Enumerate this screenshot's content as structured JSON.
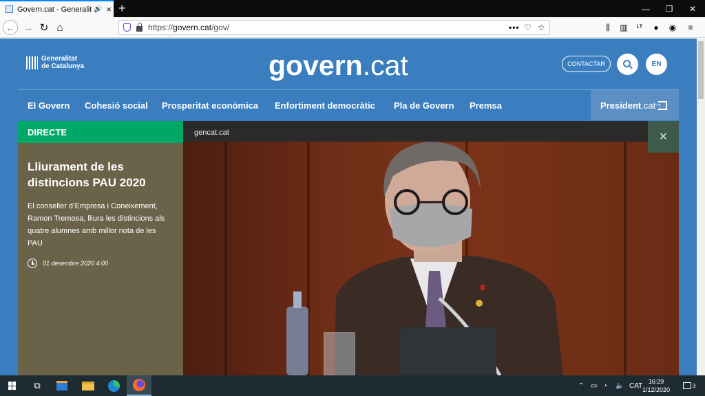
{
  "browser": {
    "tab_title": "Govern.cat - Generalitat de Catalunya",
    "tab_audio_icon": "speaker-icon",
    "tab_close": "×",
    "new_tab": "+",
    "window_minimize": "—",
    "window_restore": "❐",
    "window_close": "✕",
    "url_prefix": "https://",
    "url_domain": "govern.cat",
    "url_path": "/gov/",
    "page_actions": "•••"
  },
  "site": {
    "logo_line1": "Generalitat",
    "logo_line2": "de Catalunya",
    "brand_bold": "govern",
    "brand_light": ".cat",
    "contact_label": "CONTACTAR",
    "lang_label": "EN",
    "nav": [
      {
        "label": "El Govern"
      },
      {
        "label": "Cohesió social"
      },
      {
        "label": "Prosperitat econòmica"
      },
      {
        "label": "Enfortiment democràtic"
      },
      {
        "label": "Pla de Govern"
      },
      {
        "label": "Premsa"
      }
    ],
    "president_bold": "President",
    "president_light": ".cat",
    "live": {
      "badge": "DIRECTE",
      "title": "Lliurament de les distincions PAU 2020",
      "description": "El conseller d’Empresa i Coneixement, Ramon Tremosa, lliura les distincions als quatre alumnes amb millor nota de les PAU",
      "date": "01 desembre 2020 4:00"
    },
    "video": {
      "source_label": "gencat.cat",
      "close": "×"
    }
  },
  "taskbar": {
    "language": "CAT",
    "time": "16:29",
    "date": "1/12/2020",
    "notifications": "3"
  },
  "colors": {
    "site_blue": "#3a7ebf",
    "live_green": "#00a868",
    "live_panel": "#6b6349",
    "president_bg": "#5c8fc3"
  }
}
